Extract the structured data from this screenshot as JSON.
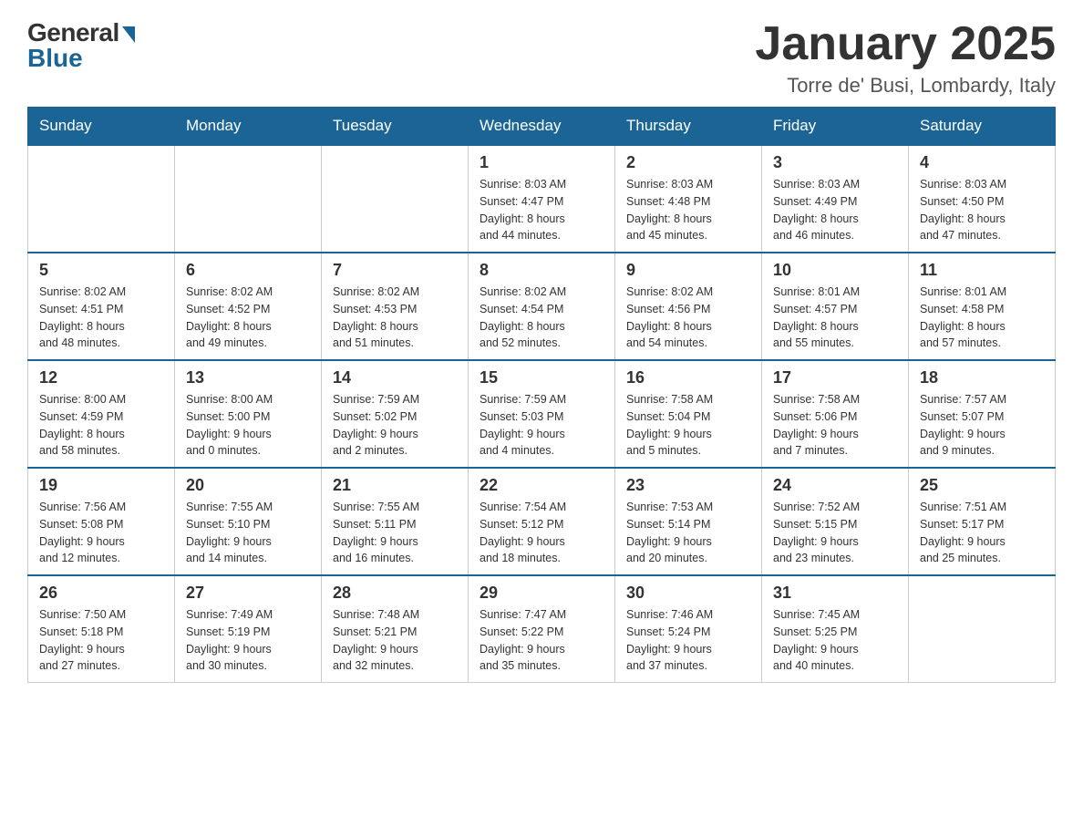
{
  "logo": {
    "general_text": "General",
    "blue_text": "Blue"
  },
  "header": {
    "month_title": "January 2025",
    "location": "Torre de' Busi, Lombardy, Italy"
  },
  "weekdays": [
    "Sunday",
    "Monday",
    "Tuesday",
    "Wednesday",
    "Thursday",
    "Friday",
    "Saturday"
  ],
  "weeks": [
    [
      {
        "day": "",
        "info": ""
      },
      {
        "day": "",
        "info": ""
      },
      {
        "day": "",
        "info": ""
      },
      {
        "day": "1",
        "info": "Sunrise: 8:03 AM\nSunset: 4:47 PM\nDaylight: 8 hours\nand 44 minutes."
      },
      {
        "day": "2",
        "info": "Sunrise: 8:03 AM\nSunset: 4:48 PM\nDaylight: 8 hours\nand 45 minutes."
      },
      {
        "day": "3",
        "info": "Sunrise: 8:03 AM\nSunset: 4:49 PM\nDaylight: 8 hours\nand 46 minutes."
      },
      {
        "day": "4",
        "info": "Sunrise: 8:03 AM\nSunset: 4:50 PM\nDaylight: 8 hours\nand 47 minutes."
      }
    ],
    [
      {
        "day": "5",
        "info": "Sunrise: 8:02 AM\nSunset: 4:51 PM\nDaylight: 8 hours\nand 48 minutes."
      },
      {
        "day": "6",
        "info": "Sunrise: 8:02 AM\nSunset: 4:52 PM\nDaylight: 8 hours\nand 49 minutes."
      },
      {
        "day": "7",
        "info": "Sunrise: 8:02 AM\nSunset: 4:53 PM\nDaylight: 8 hours\nand 51 minutes."
      },
      {
        "day": "8",
        "info": "Sunrise: 8:02 AM\nSunset: 4:54 PM\nDaylight: 8 hours\nand 52 minutes."
      },
      {
        "day": "9",
        "info": "Sunrise: 8:02 AM\nSunset: 4:56 PM\nDaylight: 8 hours\nand 54 minutes."
      },
      {
        "day": "10",
        "info": "Sunrise: 8:01 AM\nSunset: 4:57 PM\nDaylight: 8 hours\nand 55 minutes."
      },
      {
        "day": "11",
        "info": "Sunrise: 8:01 AM\nSunset: 4:58 PM\nDaylight: 8 hours\nand 57 minutes."
      }
    ],
    [
      {
        "day": "12",
        "info": "Sunrise: 8:00 AM\nSunset: 4:59 PM\nDaylight: 8 hours\nand 58 minutes."
      },
      {
        "day": "13",
        "info": "Sunrise: 8:00 AM\nSunset: 5:00 PM\nDaylight: 9 hours\nand 0 minutes."
      },
      {
        "day": "14",
        "info": "Sunrise: 7:59 AM\nSunset: 5:02 PM\nDaylight: 9 hours\nand 2 minutes."
      },
      {
        "day": "15",
        "info": "Sunrise: 7:59 AM\nSunset: 5:03 PM\nDaylight: 9 hours\nand 4 minutes."
      },
      {
        "day": "16",
        "info": "Sunrise: 7:58 AM\nSunset: 5:04 PM\nDaylight: 9 hours\nand 5 minutes."
      },
      {
        "day": "17",
        "info": "Sunrise: 7:58 AM\nSunset: 5:06 PM\nDaylight: 9 hours\nand 7 minutes."
      },
      {
        "day": "18",
        "info": "Sunrise: 7:57 AM\nSunset: 5:07 PM\nDaylight: 9 hours\nand 9 minutes."
      }
    ],
    [
      {
        "day": "19",
        "info": "Sunrise: 7:56 AM\nSunset: 5:08 PM\nDaylight: 9 hours\nand 12 minutes."
      },
      {
        "day": "20",
        "info": "Sunrise: 7:55 AM\nSunset: 5:10 PM\nDaylight: 9 hours\nand 14 minutes."
      },
      {
        "day": "21",
        "info": "Sunrise: 7:55 AM\nSunset: 5:11 PM\nDaylight: 9 hours\nand 16 minutes."
      },
      {
        "day": "22",
        "info": "Sunrise: 7:54 AM\nSunset: 5:12 PM\nDaylight: 9 hours\nand 18 minutes."
      },
      {
        "day": "23",
        "info": "Sunrise: 7:53 AM\nSunset: 5:14 PM\nDaylight: 9 hours\nand 20 minutes."
      },
      {
        "day": "24",
        "info": "Sunrise: 7:52 AM\nSunset: 5:15 PM\nDaylight: 9 hours\nand 23 minutes."
      },
      {
        "day": "25",
        "info": "Sunrise: 7:51 AM\nSunset: 5:17 PM\nDaylight: 9 hours\nand 25 minutes."
      }
    ],
    [
      {
        "day": "26",
        "info": "Sunrise: 7:50 AM\nSunset: 5:18 PM\nDaylight: 9 hours\nand 27 minutes."
      },
      {
        "day": "27",
        "info": "Sunrise: 7:49 AM\nSunset: 5:19 PM\nDaylight: 9 hours\nand 30 minutes."
      },
      {
        "day": "28",
        "info": "Sunrise: 7:48 AM\nSunset: 5:21 PM\nDaylight: 9 hours\nand 32 minutes."
      },
      {
        "day": "29",
        "info": "Sunrise: 7:47 AM\nSunset: 5:22 PM\nDaylight: 9 hours\nand 35 minutes."
      },
      {
        "day": "30",
        "info": "Sunrise: 7:46 AM\nSunset: 5:24 PM\nDaylight: 9 hours\nand 37 minutes."
      },
      {
        "day": "31",
        "info": "Sunrise: 7:45 AM\nSunset: 5:25 PM\nDaylight: 9 hours\nand 40 minutes."
      },
      {
        "day": "",
        "info": ""
      }
    ]
  ]
}
